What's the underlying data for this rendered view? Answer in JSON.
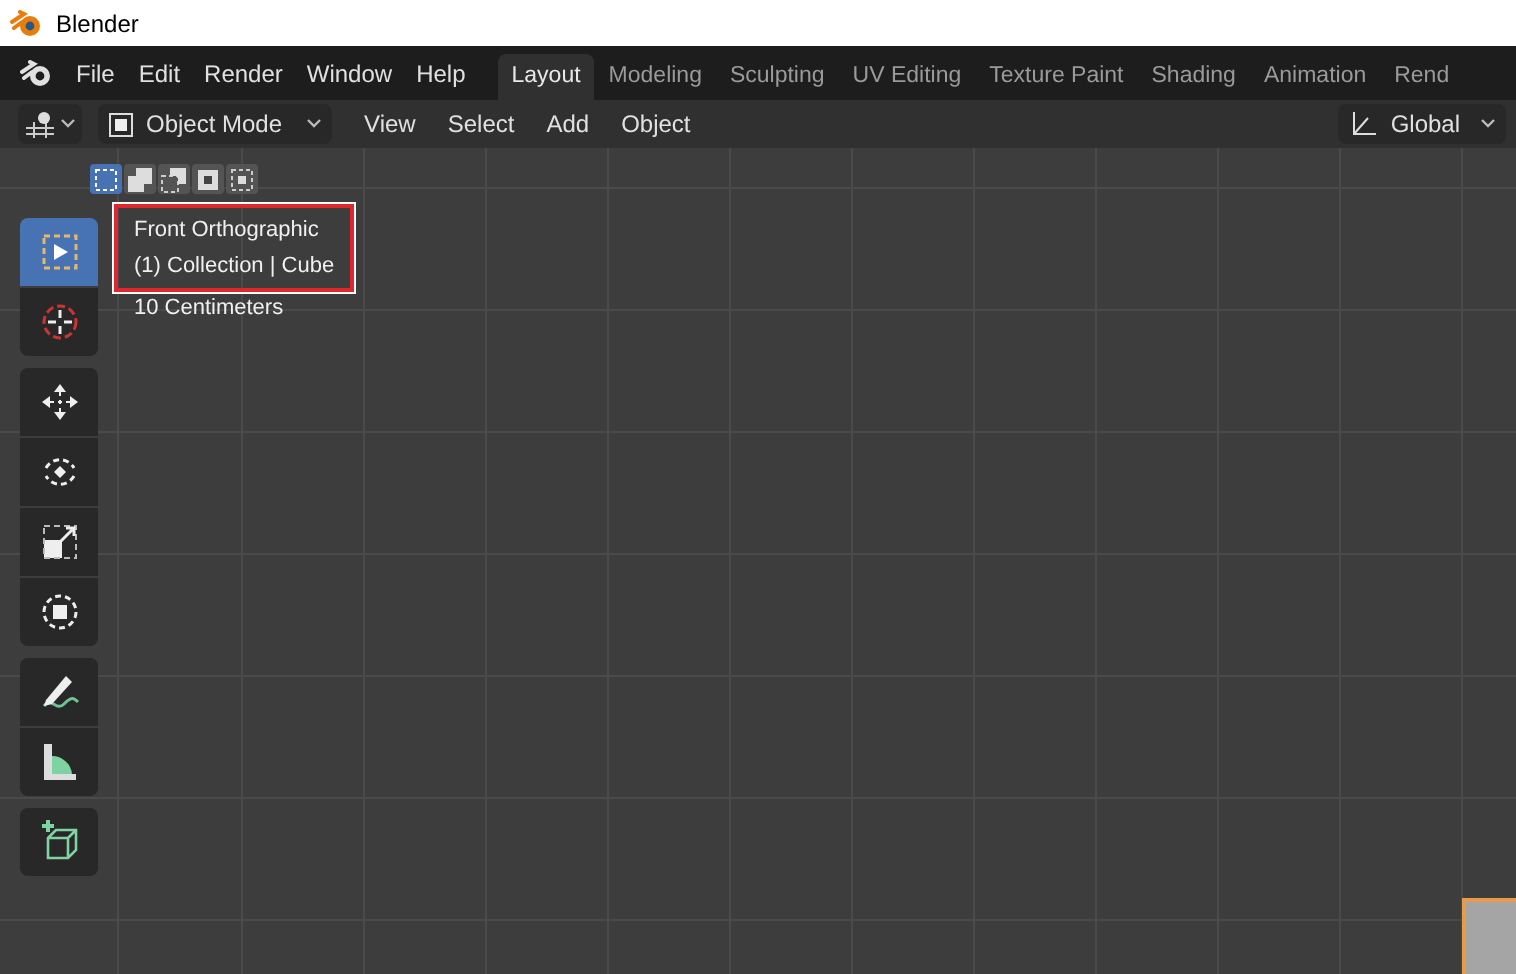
{
  "window": {
    "title": "Blender"
  },
  "menu": [
    "File",
    "Edit",
    "Render",
    "Window",
    "Help"
  ],
  "workspaces": [
    {
      "label": "Layout",
      "selected": true
    },
    {
      "label": "Modeling",
      "selected": false
    },
    {
      "label": "Sculpting",
      "selected": false
    },
    {
      "label": "UV Editing",
      "selected": false
    },
    {
      "label": "Texture Paint",
      "selected": false
    },
    {
      "label": "Shading",
      "selected": false
    },
    {
      "label": "Animation",
      "selected": false
    },
    {
      "label": "Rend",
      "selected": false
    }
  ],
  "header": {
    "mode": "Object Mode",
    "menus": [
      "View",
      "Select",
      "Add",
      "Object"
    ],
    "orientation": "Global"
  },
  "selection_modes": [
    {
      "kind": "set",
      "selected": true
    },
    {
      "kind": "extend",
      "selected": false
    },
    {
      "kind": "subtract",
      "selected": false
    },
    {
      "kind": "difference",
      "selected": false
    },
    {
      "kind": "intersect",
      "selected": false
    }
  ],
  "viewport": {
    "view_name": "Front Orthographic",
    "object_info": "(1) Collection | Cube",
    "scale": "10 Centimeters"
  },
  "tool_groups": [
    {
      "tools": [
        {
          "kind": "select",
          "selected": true
        },
        {
          "kind": "cursor",
          "selected": false
        }
      ]
    },
    {
      "tools": [
        {
          "kind": "move",
          "selected": false
        },
        {
          "kind": "rotate",
          "selected": false
        },
        {
          "kind": "scale",
          "selected": false
        },
        {
          "kind": "transform",
          "selected": false
        }
      ]
    },
    {
      "tools": [
        {
          "kind": "annotate",
          "selected": false
        },
        {
          "kind": "measure",
          "selected": false
        }
      ]
    },
    {
      "tools": [
        {
          "kind": "add-cube",
          "selected": false
        }
      ]
    }
  ]
}
